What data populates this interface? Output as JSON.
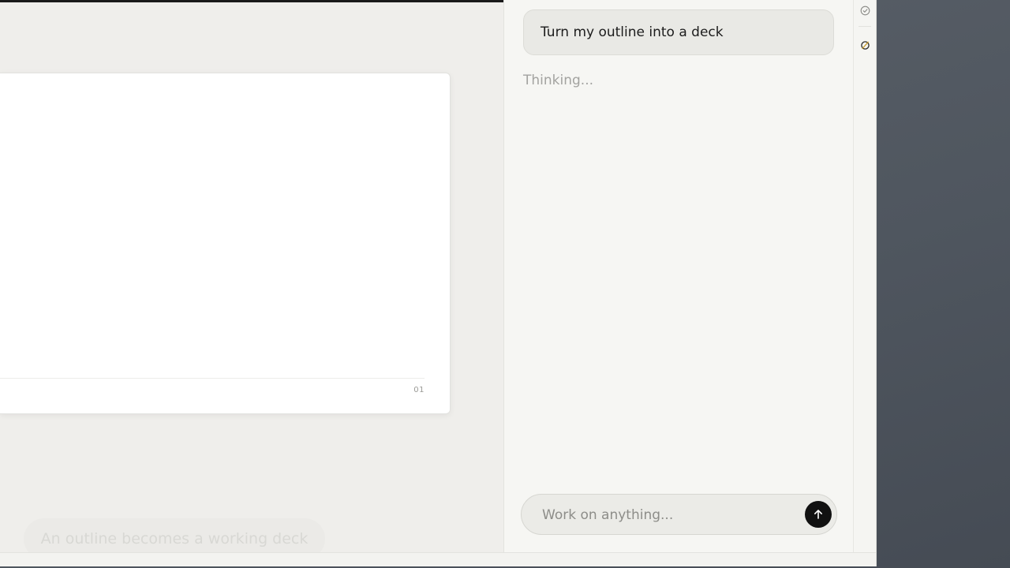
{
  "slide": {
    "page_number": "01"
  },
  "caption": {
    "text": "An outline becomes a working deck"
  },
  "chat": {
    "user_message": "Turn my outline into a deck",
    "status": "Thinking...",
    "composer_placeholder": "Work on anything..."
  },
  "rail": {
    "icons": [
      "check-circle-icon",
      "slash-circle-icon"
    ]
  },
  "colors": {
    "send_button": "#111111",
    "accent_icon": "#c79a2a"
  }
}
